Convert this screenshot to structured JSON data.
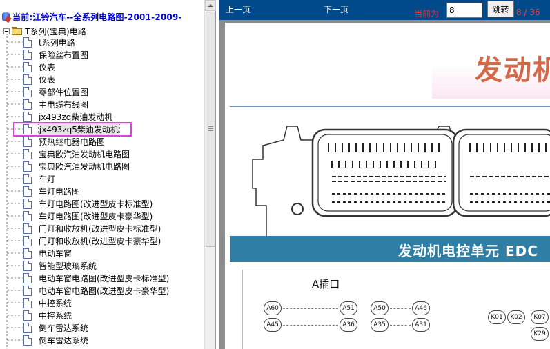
{
  "left_panel": {
    "header_title": "当前:江铃汽车--全系列电路图-2001-2009-",
    "root_label": "T系列(宝典)电路",
    "items": [
      {
        "label": "t系列电路"
      },
      {
        "label": "保险丝布置图"
      },
      {
        "label": "仪表"
      },
      {
        "label": "仪表"
      },
      {
        "label": "零部件位置图"
      },
      {
        "label": "主电缆布线图"
      },
      {
        "label": "jx493zq柴油发动机"
      },
      {
        "label": "jx493zq5柴油发动机"
      },
      {
        "label": "预热继电器电路图"
      },
      {
        "label": "宝典欧汽油发动机电路图"
      },
      {
        "label": "宝典欧汽油发动机电路图"
      },
      {
        "label": "车灯"
      },
      {
        "label": "车灯电路图"
      },
      {
        "label": "车灯电路图(改进型皮卡标准型)"
      },
      {
        "label": "车灯电路图(改进型皮卡豪华型)"
      },
      {
        "label": "门灯和收放机(改进型皮卡标准型)"
      },
      {
        "label": "门灯和收放机(改进型皮卡豪华型)"
      },
      {
        "label": "电动车窗"
      },
      {
        "label": "智能型玻璃系统"
      },
      {
        "label": "电动车窗电路图(改进型皮卡标准型)"
      },
      {
        "label": "电动车窗电路图(改进型皮卡豪华型)"
      },
      {
        "label": "中控系统"
      },
      {
        "label": "中控系统"
      },
      {
        "label": "倒车雷达系统"
      },
      {
        "label": "倒车雷达系统"
      }
    ],
    "selected_index": 7
  },
  "toolbar": {
    "prev_label": "上一页",
    "next_label": "下一页",
    "current_label": "当前为",
    "page_value": "8",
    "goto_label": "跳转",
    "page_count": "8 / 36"
  },
  "document": {
    "title": "发动机",
    "band_text": "发动机电控单元 EDC",
    "section_label": "A插口",
    "pins_left": [
      [
        "A60",
        "A51"
      ],
      [
        "A45",
        "A36"
      ]
    ],
    "pins_mid": [
      [
        "A50",
        "A46"
      ],
      [
        "A35",
        "A31"
      ]
    ],
    "pins_right": [
      "K01",
      "K02",
      "K07",
      "K29"
    ]
  },
  "colors": {
    "toolbar_bg": "#004a8c",
    "header_text": "#0000cc",
    "highlight_box": "#e040e0",
    "doc_title": "#d4694a",
    "band": "#2f7ea6"
  }
}
